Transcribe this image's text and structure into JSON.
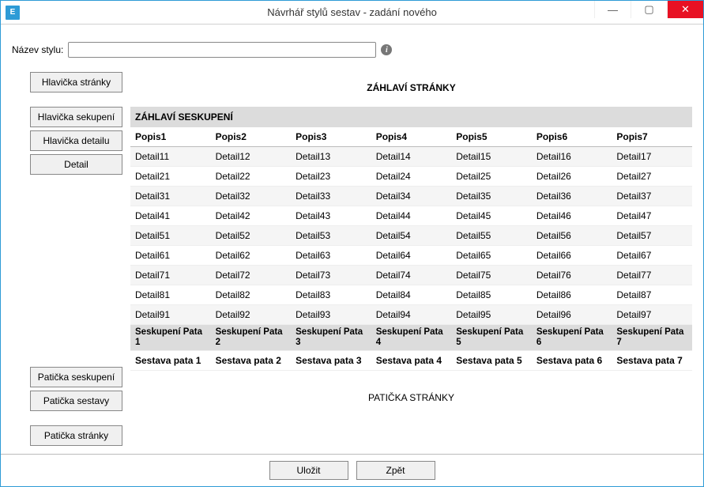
{
  "window": {
    "title": "Návrhář stylů sestav - zadání nového",
    "icon_letter": "E"
  },
  "name_row": {
    "label": "Název stylu:",
    "value": "",
    "placeholder": ""
  },
  "side_buttons": {
    "page_header": "Hlavička stránky",
    "group_header": "Hlavička sekupení",
    "detail_header": "Hlavička detailu",
    "detail": "Detail",
    "group_footer": "Patička seskupení",
    "report_footer": "Patička sestavy",
    "page_footer": "Patička stránky"
  },
  "bands": {
    "page_header": "ZÁHLAVÍ STRÁNKY",
    "group_header": "ZÁHLAVÍ SESKUPENÍ",
    "page_footer": "PATIČKA STRÁNKY"
  },
  "columns": [
    "Popis1",
    "Popis2",
    "Popis3",
    "Popis4",
    "Popis5",
    "Popis6",
    "Popis7"
  ],
  "detail_rows": [
    [
      "Detail11",
      "Detail12",
      "Detail13",
      "Detail14",
      "Detail15",
      "Detail16",
      "Detail17"
    ],
    [
      "Detail21",
      "Detail22",
      "Detail23",
      "Detail24",
      "Detail25",
      "Detail26",
      "Detail27"
    ],
    [
      "Detail31",
      "Detail32",
      "Detail33",
      "Detail34",
      "Detail35",
      "Detail36",
      "Detail37"
    ],
    [
      "Detail41",
      "Detail42",
      "Detail43",
      "Detail44",
      "Detail45",
      "Detail46",
      "Detail47"
    ],
    [
      "Detail51",
      "Detail52",
      "Detail53",
      "Detail54",
      "Detail55",
      "Detail56",
      "Detail57"
    ],
    [
      "Detail61",
      "Detail62",
      "Detail63",
      "Detail64",
      "Detail65",
      "Detail66",
      "Detail67"
    ],
    [
      "Detail71",
      "Detail72",
      "Detail73",
      "Detail74",
      "Detail75",
      "Detail76",
      "Detail77"
    ],
    [
      "Detail81",
      "Detail82",
      "Detail83",
      "Detail84",
      "Detail85",
      "Detail86",
      "Detail87"
    ],
    [
      "Detail91",
      "Detail92",
      "Detail93",
      "Detail94",
      "Detail95",
      "Detail96",
      "Detail97"
    ]
  ],
  "group_footer_row": [
    "Seskupení Pata 1",
    "Seskupení Pata 2",
    "Seskupení Pata 3",
    "Seskupení Pata 4",
    "Seskupení Pata 5",
    "Seskupení Pata 6",
    "Seskupení Pata 7"
  ],
  "report_footer_row": [
    "Sestava pata 1",
    "Sestava pata 2",
    "Sestava pata 3",
    "Sestava pata 4",
    "Sestava pata 5",
    "Sestava pata 6",
    "Sestava pata 7"
  ],
  "dialog_buttons": {
    "save": "Uložit",
    "back": "Zpět"
  }
}
